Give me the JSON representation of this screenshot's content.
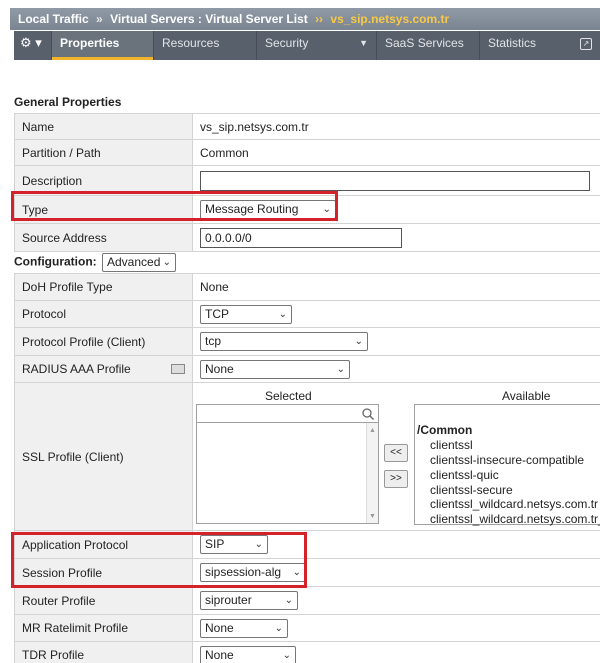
{
  "breadcrumb": {
    "root": "Local Traffic",
    "level2": "Virtual Servers : Virtual Server List",
    "current": "vs_sip.netsys.com.tr",
    "sep": "»",
    "cur_sep": "››"
  },
  "tabs": {
    "gear": "⚙ ▾",
    "items": [
      {
        "label": "Properties",
        "active": true
      },
      {
        "label": "Resources"
      },
      {
        "label": "Security",
        "dropdown": "▼"
      },
      {
        "label": "SaaS Services"
      },
      {
        "label": "Statistics",
        "popout": "↗"
      }
    ]
  },
  "general": {
    "title": "General Properties",
    "rows": {
      "name": {
        "label": "Name",
        "value": "vs_sip.netsys.com.tr"
      },
      "partition": {
        "label": "Partition / Path",
        "value": "Common"
      },
      "description": {
        "label": "Description",
        "value": ""
      },
      "type": {
        "label": "Type",
        "value": "Message Routing"
      },
      "source": {
        "label": "Source Address",
        "value": "0.0.0.0/0"
      }
    }
  },
  "config": {
    "title": "Configuration:",
    "mode": "Advanced",
    "rows": {
      "doh": {
        "label": "DoH Profile Type",
        "value": "None"
      },
      "protocol": {
        "label": "Protocol",
        "value": "TCP"
      },
      "protocol_profile": {
        "label": "Protocol Profile (Client)",
        "value": "tcp"
      },
      "radius": {
        "label": "RADIUS AAA Profile",
        "value": "None"
      },
      "ssl": {
        "label": "SSL Profile (Client)"
      },
      "app_protocol": {
        "label": "Application Protocol",
        "value": "SIP"
      },
      "session": {
        "label": "Session Profile",
        "value": "sipsession-alg"
      },
      "router": {
        "label": "Router Profile",
        "value": "siprouter"
      },
      "ratelimit": {
        "label": "MR Ratelimit Profile",
        "value": "None"
      },
      "tdr": {
        "label": "TDR Profile",
        "value": "None"
      }
    }
  },
  "ssl_list": {
    "selected_label": "Selected",
    "available_label": "Available",
    "move_left": "<<",
    "move_right": ">>",
    "available": [
      "/Common",
      "clientssl",
      "clientssl-insecure-compatible",
      "clientssl-quic",
      "clientssl-secure",
      "clientssl_wildcard.netsys.com.tr",
      "clientssl_wildcard.netsys.com.tr_c"
    ]
  },
  "colors": {
    "highlight": "#d3222a",
    "tab_bar": "#58606b",
    "active_underline": "#f0b429",
    "breadcrumb_current": "#f7c948"
  }
}
